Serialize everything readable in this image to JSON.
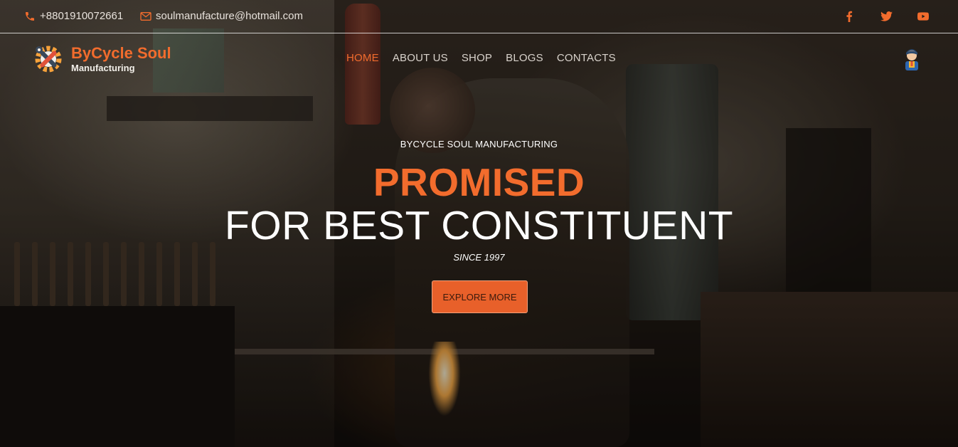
{
  "colors": {
    "accent": "#f26c2d",
    "text_light": "#ffffff",
    "nav_text": "#d9d3cc"
  },
  "topbar": {
    "phone": {
      "icon": "phone-icon",
      "text": "+8801910072661"
    },
    "email": {
      "icon": "mail-icon",
      "text": "soulmanufacture@hotmail.com"
    },
    "socials": [
      {
        "icon": "facebook-icon"
      },
      {
        "icon": "twitter-icon"
      },
      {
        "icon": "youtube-icon"
      }
    ]
  },
  "header": {
    "logo_icon": "gear-wrench-logo-icon",
    "brand_name": "ByCycle Soul",
    "brand_sub": "Manufacturing",
    "nav": [
      {
        "label": "HOME",
        "active": true
      },
      {
        "label": "ABOUT US",
        "active": false
      },
      {
        "label": "SHOP",
        "active": false
      },
      {
        "label": "BLOGS",
        "active": false
      },
      {
        "label": "CONTACTS",
        "active": false
      }
    ],
    "avatar_icon": "user-avatar-icon"
  },
  "hero": {
    "kicker": "BYCYCLE SOUL MANUFACTURING",
    "headline_accent": "PROMISED",
    "headline_main": "FOR BEST CONSTITUENT",
    "since": "SINCE 1997",
    "cta_label": "EXPLORE MORE"
  }
}
